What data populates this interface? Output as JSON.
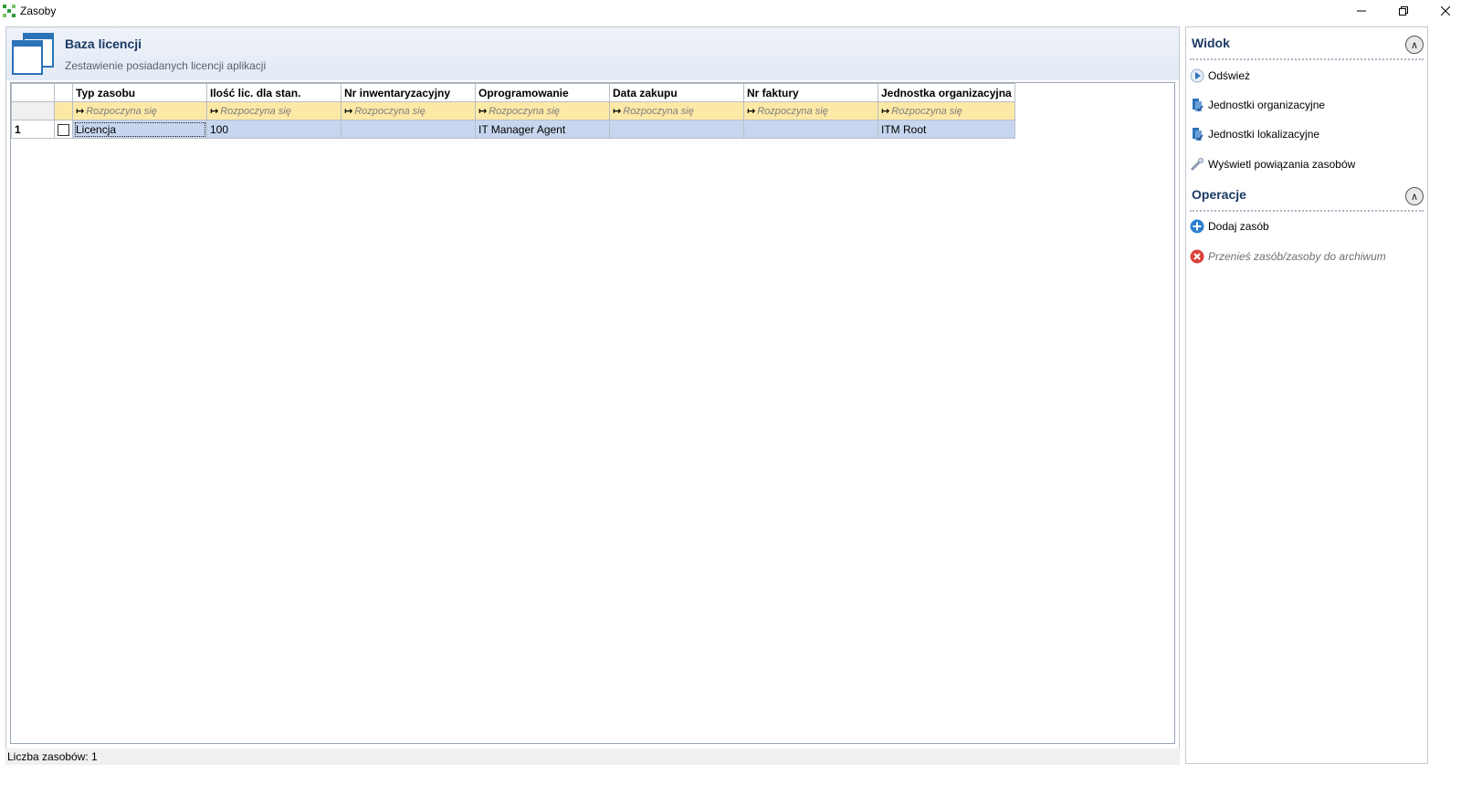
{
  "window": {
    "title": "Zasoby",
    "controls": {
      "minimize": "—",
      "restore": "❐",
      "close": "✕"
    }
  },
  "header": {
    "title": "Baza licencji",
    "subtitle": "Zestawienie posiadanych licencji aplikacji"
  },
  "grid": {
    "columns": [
      "Typ zasobu",
      "Ilość lic. dla stan.",
      "Nr inwentaryzacyjny",
      "Oprogramowanie",
      "Data zakupu",
      "Nr faktury",
      "Jednostka organizacyjna"
    ],
    "filter_placeholder": "Rozpoczyna się",
    "rows": [
      {
        "num": "1",
        "cells": [
          "Licencja",
          "100",
          "",
          "IT Manager Agent",
          "",
          "",
          "ITM Root"
        ]
      }
    ]
  },
  "status": {
    "text": "Liczba zasobów: 1"
  },
  "side": {
    "view": {
      "title": "Widok",
      "items": [
        {
          "label": "Odśwież",
          "icon": "refresh-icon"
        },
        {
          "label": "Jednostki organizacyjne",
          "icon": "org-units-icon"
        },
        {
          "label": "Jednostki lokalizacyjne",
          "icon": "location-units-icon"
        },
        {
          "label": "Wyświetl powiązania zasobów",
          "icon": "link-icon"
        }
      ]
    },
    "operations": {
      "title": "Operacje",
      "items": [
        {
          "label": "Dodaj zasób",
          "icon": "add-icon"
        },
        {
          "label": "Przenieś zasób/zasoby do archiwum",
          "icon": "remove-icon"
        }
      ]
    }
  },
  "colors": {
    "accent": "#1b3a63",
    "filter_row": "#fde9a6",
    "selected_row": "#c7d6ee"
  }
}
